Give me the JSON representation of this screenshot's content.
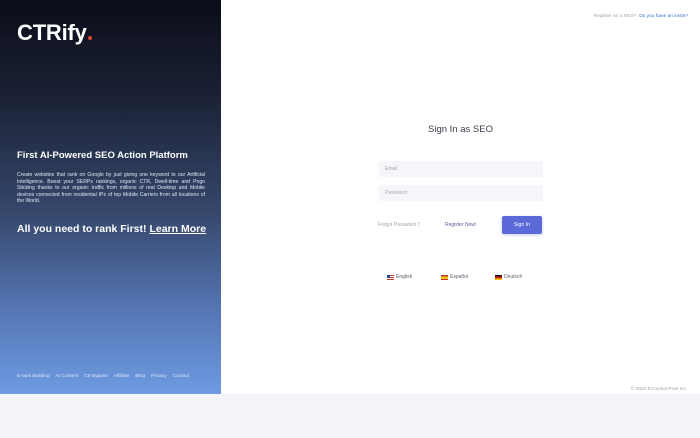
{
  "brand": {
    "logo_text": "CTRify"
  },
  "left_panel": {
    "tagline": "First AI-Powered SEO Action Platform",
    "description": "Create websites that rank on Google by just giving one keyword to our Artificial Intelligence. Boost your SERPs rankings, organic CTR, Dwell-time and Pogo Sticking thanks to our organic traffic from millions of real Desktop and Mobile devices connected from residential IPs of top Mobile Carriers from all locations of the World.",
    "rank_text": "All you need to rank First!",
    "learn_more": "Learn More",
    "footer_links": [
      "E-rank Building",
      "AI Content",
      "Ctr Bypass",
      "Affiliate",
      "Blog",
      "Privacy",
      "Contact"
    ]
  },
  "header": {
    "question": "Register as a SEO?",
    "invite_link": "Do you have an invite?"
  },
  "form": {
    "title": "Sign In as SEO",
    "email_placeholder": "Email",
    "password_placeholder": "Password",
    "forgot_password": "Forgot Password ?",
    "register_now": "Register Now!",
    "sign_in": "Sign In"
  },
  "languages": [
    {
      "label": "English",
      "flag": "us-flag-icon"
    },
    {
      "label": "Español",
      "flag": "es-flag-icon"
    },
    {
      "label": "Deutsch",
      "flag": "de-flag-icon"
    }
  ],
  "footer": {
    "copyright": "© 2025 ExcursionPost Inc"
  },
  "colors": {
    "accent": "#5b6ad8",
    "link": "#3b6bd1",
    "logo_dot": "#e0433a"
  }
}
